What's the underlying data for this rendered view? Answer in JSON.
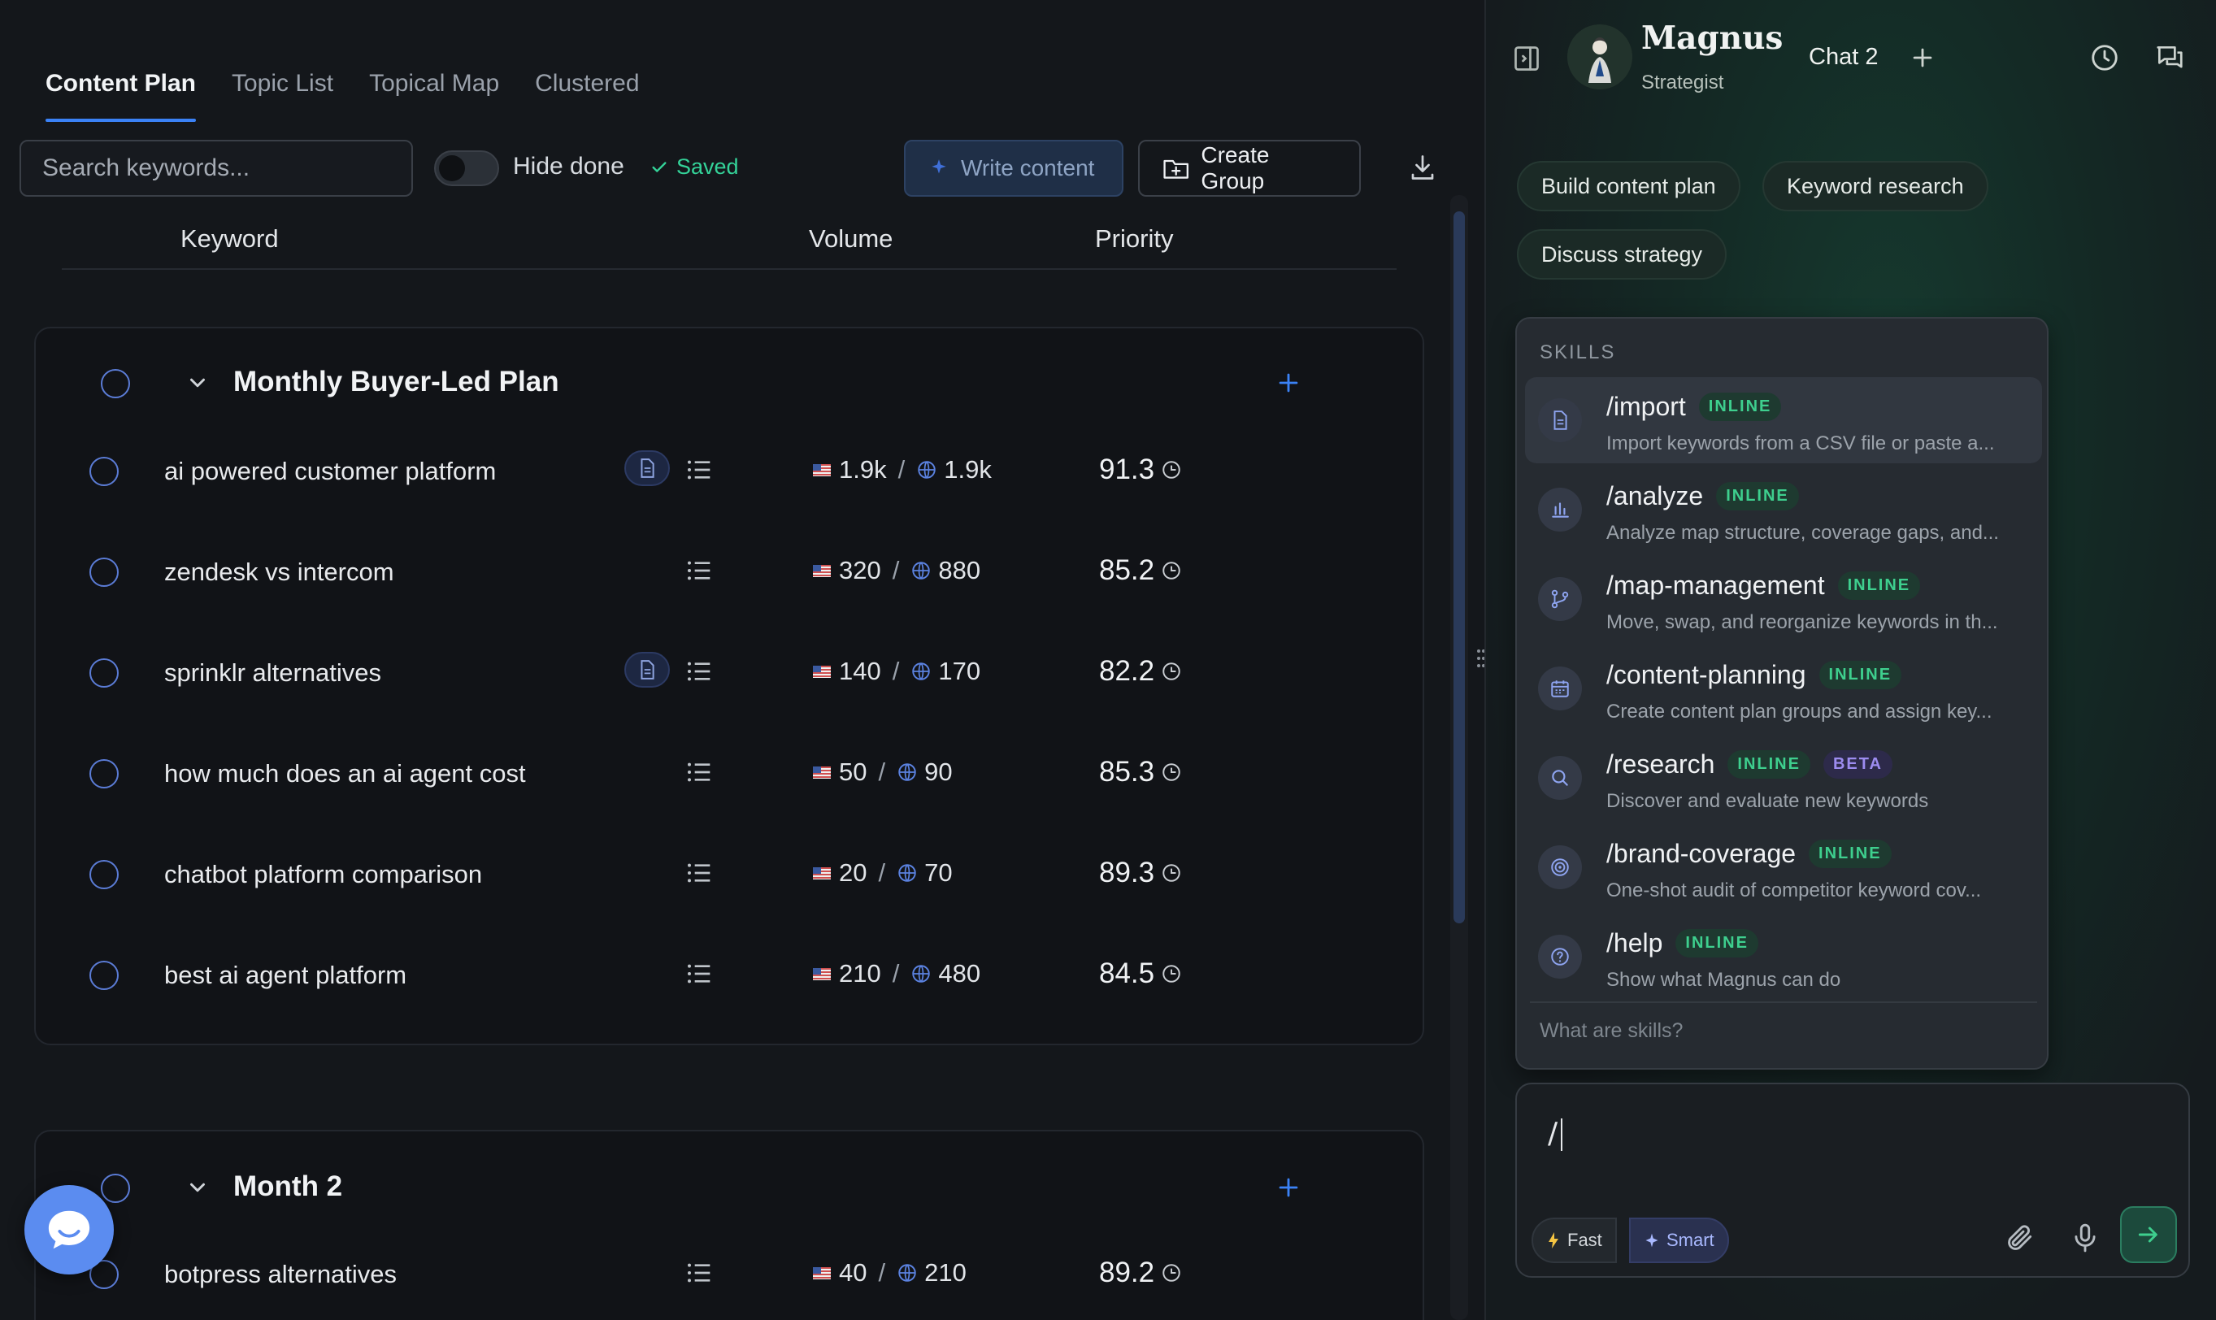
{
  "tabs": [
    "Content Plan",
    "Topic List",
    "Topical Map",
    "Clustered"
  ],
  "toolbar": {
    "search_placeholder": "Search keywords...",
    "hide_done_label": "Hide done",
    "saved_label": "Saved",
    "write_content_label": "Write content",
    "create_group_label": "Create Group"
  },
  "table_headers": {
    "keyword": "Keyword",
    "volume": "Volume",
    "priority": "Priority"
  },
  "groups": [
    {
      "title": "Monthly Buyer-Led Plan",
      "rows": [
        {
          "keyword": "ai powered customer platform",
          "us_volume": "1.9k",
          "global_volume": "1.9k",
          "priority": "91.3",
          "has_doc": true
        },
        {
          "keyword": "zendesk vs intercom",
          "us_volume": "320",
          "global_volume": "880",
          "priority": "85.2",
          "has_doc": false
        },
        {
          "keyword": "sprinklr alternatives",
          "us_volume": "140",
          "global_volume": "170",
          "priority": "82.2",
          "has_doc": true
        },
        {
          "keyword": "how much does an ai agent cost",
          "us_volume": "50",
          "global_volume": "90",
          "priority": "85.3",
          "has_doc": false
        },
        {
          "keyword": "chatbot platform comparison",
          "us_volume": "20",
          "global_volume": "70",
          "priority": "89.3",
          "has_doc": false
        },
        {
          "keyword": "best ai agent platform",
          "us_volume": "210",
          "global_volume": "480",
          "priority": "84.5",
          "has_doc": false
        }
      ]
    },
    {
      "title": "Month 2",
      "rows": [
        {
          "keyword": "botpress alternatives",
          "us_volume": "40",
          "global_volume": "210",
          "priority": "89.2",
          "has_doc": false
        }
      ]
    }
  ],
  "assistant": {
    "name": "Magnus",
    "role": "Strategist",
    "chat_title": "Chat 2",
    "suggestions": [
      "Build content plan",
      "Keyword research",
      "Discuss strategy"
    ],
    "skills_header": "SKILLS",
    "skills": [
      {
        "name": "/import",
        "badges": [
          "INLINE"
        ],
        "desc": "Import keywords from a CSV file or paste a...",
        "icon": "file-icon"
      },
      {
        "name": "/analyze",
        "badges": [
          "INLINE"
        ],
        "desc": "Analyze map structure, coverage gaps, and...",
        "icon": "bar-chart-icon"
      },
      {
        "name": "/map-management",
        "badges": [
          "INLINE"
        ],
        "desc": "Move, swap, and reorganize keywords in th...",
        "icon": "branch-icon"
      },
      {
        "name": "/content-planning",
        "badges": [
          "INLINE"
        ],
        "desc": "Create content plan groups and assign key...",
        "icon": "calendar-icon"
      },
      {
        "name": "/research",
        "badges": [
          "INLINE",
          "BETA"
        ],
        "desc": "Discover and evaluate new keywords",
        "icon": "search-icon"
      },
      {
        "name": "/brand-coverage",
        "badges": [
          "INLINE"
        ],
        "desc": "One-shot audit of competitor keyword cov...",
        "icon": "target-icon"
      },
      {
        "name": "/help",
        "badges": [
          "INLINE"
        ],
        "desc": "Show what Magnus can do",
        "icon": "help-icon"
      }
    ],
    "skills_footer": "What are skills?",
    "composer_value": "/",
    "mode_fast": "Fast",
    "mode_smart": "Smart"
  },
  "colors": {
    "accent": "#3b82f6",
    "success": "#34d399",
    "inline_badge": "#3ecf8e",
    "beta_badge": "#9d8cf0"
  }
}
